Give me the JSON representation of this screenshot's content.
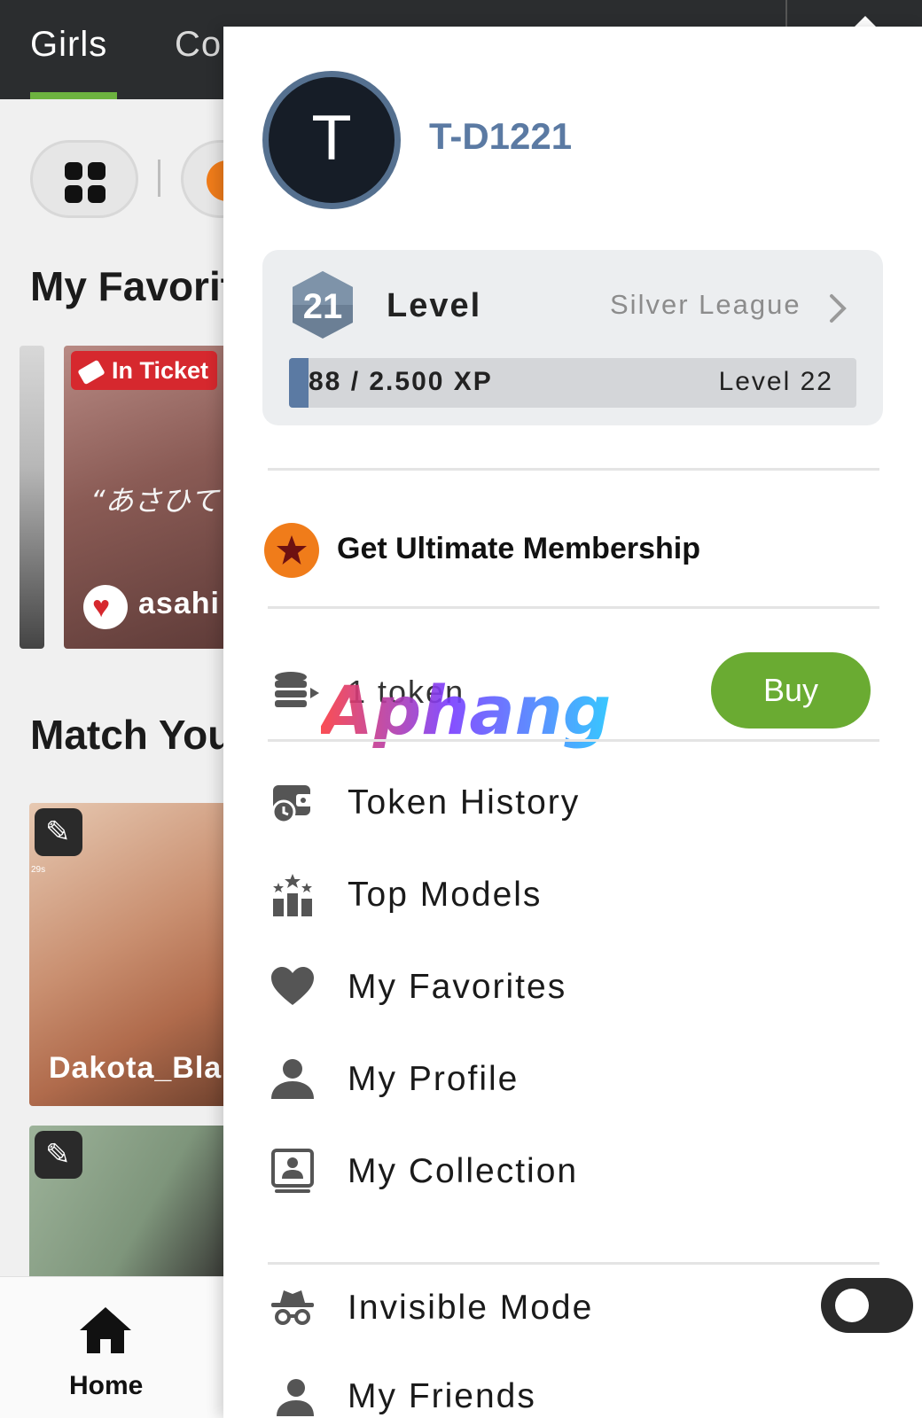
{
  "tabs": [
    {
      "label": "Girls",
      "active": true
    },
    {
      "label": "Co",
      "active": false
    }
  ],
  "background": {
    "favorites_title": "My Favorit",
    "match_title": "Match You",
    "favorite_card": {
      "badge": "In Ticket",
      "quote": "“あさひて",
      "name": "asahi"
    },
    "match_card": {
      "name": "Dakota_Bla",
      "timer": "29s"
    }
  },
  "bottom_nav": {
    "home_label": "Home"
  },
  "drawer": {
    "avatar_letter": "T",
    "username": "T-D1221",
    "level": {
      "number": "21",
      "label": "Level",
      "league": "Silver League",
      "xp_text": "88 / 2.500 XP",
      "next_level": "Level 22",
      "progress": 0.035
    },
    "premium": {
      "label": "Get Ultimate Membership"
    },
    "tokens": {
      "count_text": "1 token",
      "buy_label": "Buy"
    },
    "menu": [
      {
        "label": "Token History",
        "icon": "wallet-clock-icon"
      },
      {
        "label": "Top Models",
        "icon": "podium-stars-icon"
      },
      {
        "label": "My Favorites",
        "icon": "heart-icon"
      },
      {
        "label": "My Profile",
        "icon": "person-icon"
      },
      {
        "label": "My Collection",
        "icon": "portrait-frame-icon"
      }
    ],
    "invisible_mode": {
      "label": "Invisible Mode",
      "enabled": false
    },
    "next_item": {
      "label": "My Friends"
    }
  },
  "colors": {
    "accent_green": "#6aab32",
    "premium_orange": "#f07c1a",
    "level_blue": "#5b7aa3",
    "topbar": "#2b2d2f"
  }
}
